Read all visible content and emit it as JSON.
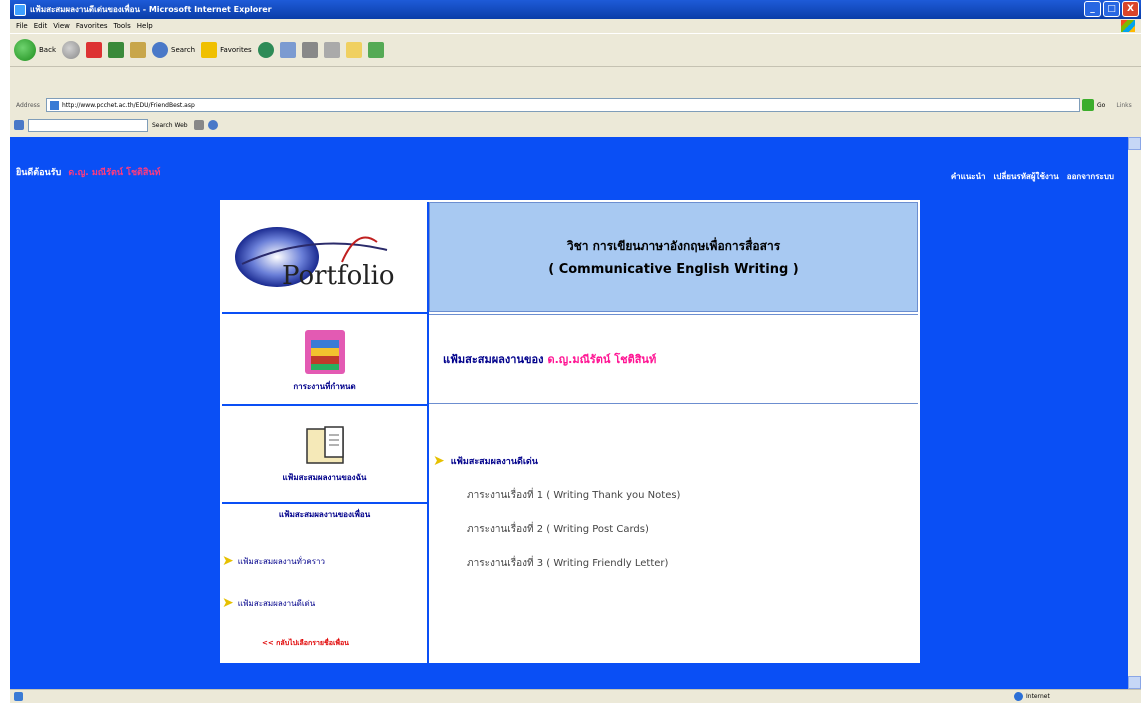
{
  "window": {
    "title": "แฟ้มสะสมผลงานดีเด่นของเพื่อน - Microsoft Internet Explorer",
    "minimize": "_",
    "maximize": "□",
    "close": "X"
  },
  "menu": [
    "File",
    "Edit",
    "View",
    "Favorites",
    "Tools",
    "Help"
  ],
  "toolbar": {
    "back": "Back",
    "search": "Search",
    "favorites": "Favorites"
  },
  "address": {
    "label": "Address",
    "url": "http://www.pcchet.ac.th/EDU/FriendBest.asp",
    "go": "Go",
    "links": "Links"
  },
  "links_bar": {
    "search_web": "Search Web"
  },
  "page": {
    "welcome": "ยินดีต้อนรับ",
    "username": "ด.ญ. มณีรัตน์ โชติสินท์",
    "topnav": [
      "คำแนะนำ",
      "เปลี่ยนรหัสผู้ใช้งาน",
      "ออกจากระบบ"
    ],
    "logo_text": "Portfolio",
    "course_th": "วิชา การเขียนภาษาอังกฤษเพื่อการสื่อสาร",
    "course_en": "( Communicative English Writing )",
    "assign_label": "การะงานที่กำหนด",
    "owner_prefix": "แฟ้มสะสมผลงานของ",
    "owner_name": "ด.ญ.มณีรัตน์ โชติสินท์",
    "my_portfolio": "แฟ้มสะสมผลงานของฉัน",
    "friend_portfolio": "แฟ้มสะสมผลงานของเพื่อน",
    "friend_general": "แฟ้มสะสมผลงานทั่วคราว",
    "friend_best": "แฟ้มสะสมผลงานดีเด่น",
    "back_link": "<< กลับไปเลือกรายชื่อเพื่อน",
    "best_heading": "แฟ้มสะสมผลงานดีเด่น",
    "works": [
      "ภาระงานเรื่องที่ 1 ( Writing Thank you Notes)",
      "ภาระงานเรื่องที่ 2 ( Writing Post Cards)",
      "ภาระงานเรื่องที่ 3 ( Writing Friendly Letter)"
    ]
  },
  "status": {
    "zone": "Internet"
  }
}
